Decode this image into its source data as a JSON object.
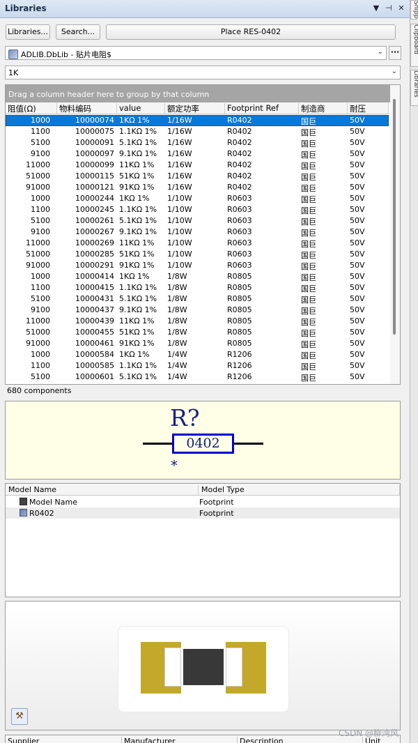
{
  "window": {
    "title": "Libraries"
  },
  "side_tabs": [
    "Snippets",
    "Clipboard",
    "Libraries"
  ],
  "toolbar": {
    "libraries_label": "Libraries...",
    "search_label": "Search...",
    "place_label": "Place RES-0402"
  },
  "library_select": {
    "value": "ADLIB.DbLib - 贴片电阻$"
  },
  "filter": {
    "value": "1K"
  },
  "grid": {
    "group_hint": "Drag a column header here to group by that column",
    "columns": [
      "阻值(Ω)",
      "物料编码",
      "value",
      "额定功率",
      "Footprint Ref",
      "制造商",
      "耐压"
    ],
    "rows": [
      [
        "1000",
        "10000074",
        "1KΩ 1%",
        "1/16W",
        "R0402",
        "国巨",
        "50V"
      ],
      [
        "1100",
        "10000075",
        "1.1KΩ 1%",
        "1/16W",
        "R0402",
        "国巨",
        "50V"
      ],
      [
        "5100",
        "10000091",
        "5.1KΩ 1%",
        "1/16W",
        "R0402",
        "国巨",
        "50V"
      ],
      [
        "9100",
        "10000097",
        "9.1KΩ 1%",
        "1/16W",
        "R0402",
        "国巨",
        "50V"
      ],
      [
        "11000",
        "10000099",
        "11KΩ 1%",
        "1/16W",
        "R0402",
        "国巨",
        "50V"
      ],
      [
        "51000",
        "10000115",
        "51KΩ 1%",
        "1/16W",
        "R0402",
        "国巨",
        "50V"
      ],
      [
        "91000",
        "10000121",
        "91KΩ 1%",
        "1/16W",
        "R0402",
        "国巨",
        "50V"
      ],
      [
        "1000",
        "10000244",
        "1KΩ 1%",
        "1/10W",
        "R0603",
        "国巨",
        "50V"
      ],
      [
        "1100",
        "10000245",
        "1.1KΩ 1%",
        "1/10W",
        "R0603",
        "国巨",
        "50V"
      ],
      [
        "5100",
        "10000261",
        "5.1KΩ 1%",
        "1/10W",
        "R0603",
        "国巨",
        "50V"
      ],
      [
        "9100",
        "10000267",
        "9.1KΩ 1%",
        "1/10W",
        "R0603",
        "国巨",
        "50V"
      ],
      [
        "11000",
        "10000269",
        "11KΩ 1%",
        "1/10W",
        "R0603",
        "国巨",
        "50V"
      ],
      [
        "51000",
        "10000285",
        "51KΩ 1%",
        "1/10W",
        "R0603",
        "国巨",
        "50V"
      ],
      [
        "91000",
        "10000291",
        "91KΩ 1%",
        "1/10W",
        "R0603",
        "国巨",
        "50V"
      ],
      [
        "1000",
        "10000414",
        "1KΩ 1%",
        "1/8W",
        "R0805",
        "国巨",
        "50V"
      ],
      [
        "1100",
        "10000415",
        "1.1KΩ 1%",
        "1/8W",
        "R0805",
        "国巨",
        "50V"
      ],
      [
        "5100",
        "10000431",
        "5.1KΩ 1%",
        "1/8W",
        "R0805",
        "国巨",
        "50V"
      ],
      [
        "9100",
        "10000437",
        "9.1KΩ 1%",
        "1/8W",
        "R0805",
        "国巨",
        "50V"
      ],
      [
        "11000",
        "10000439",
        "11KΩ 1%",
        "1/8W",
        "R0805",
        "国巨",
        "50V"
      ],
      [
        "51000",
        "10000455",
        "51KΩ 1%",
        "1/8W",
        "R0805",
        "国巨",
        "50V"
      ],
      [
        "91000",
        "10000461",
        "91KΩ 1%",
        "1/8W",
        "R0805",
        "国巨",
        "50V"
      ],
      [
        "1000",
        "10000584",
        "1KΩ 1%",
        "1/4W",
        "R1206",
        "国巨",
        "50V"
      ],
      [
        "1100",
        "10000585",
        "1.1KΩ 1%",
        "1/4W",
        "R1206",
        "国巨",
        "50V"
      ],
      [
        "5100",
        "10000601",
        "5.1KΩ 1%",
        "1/4W",
        "R1206",
        "国巨",
        "50V"
      ]
    ],
    "selected_row": 0,
    "count_text": "680 components"
  },
  "schematic": {
    "designator": "R?",
    "value": "0402",
    "comment": "*"
  },
  "models": {
    "columns": [
      "Model Name",
      "Model Type"
    ],
    "rows": [
      [
        "Model Name",
        "Footprint"
      ],
      [
        "R0402",
        "Footprint"
      ]
    ]
  },
  "supplier_columns": [
    "Supplier",
    "Manufacturer",
    "Description",
    "Unit Price"
  ],
  "watermark": "CSDN @柳湾风",
  "colors": {
    "selection": "#0a78d7",
    "pad": "#c4a82a",
    "schematic_blue": "#0000d0",
    "preview_bg": "#ffffe8"
  }
}
